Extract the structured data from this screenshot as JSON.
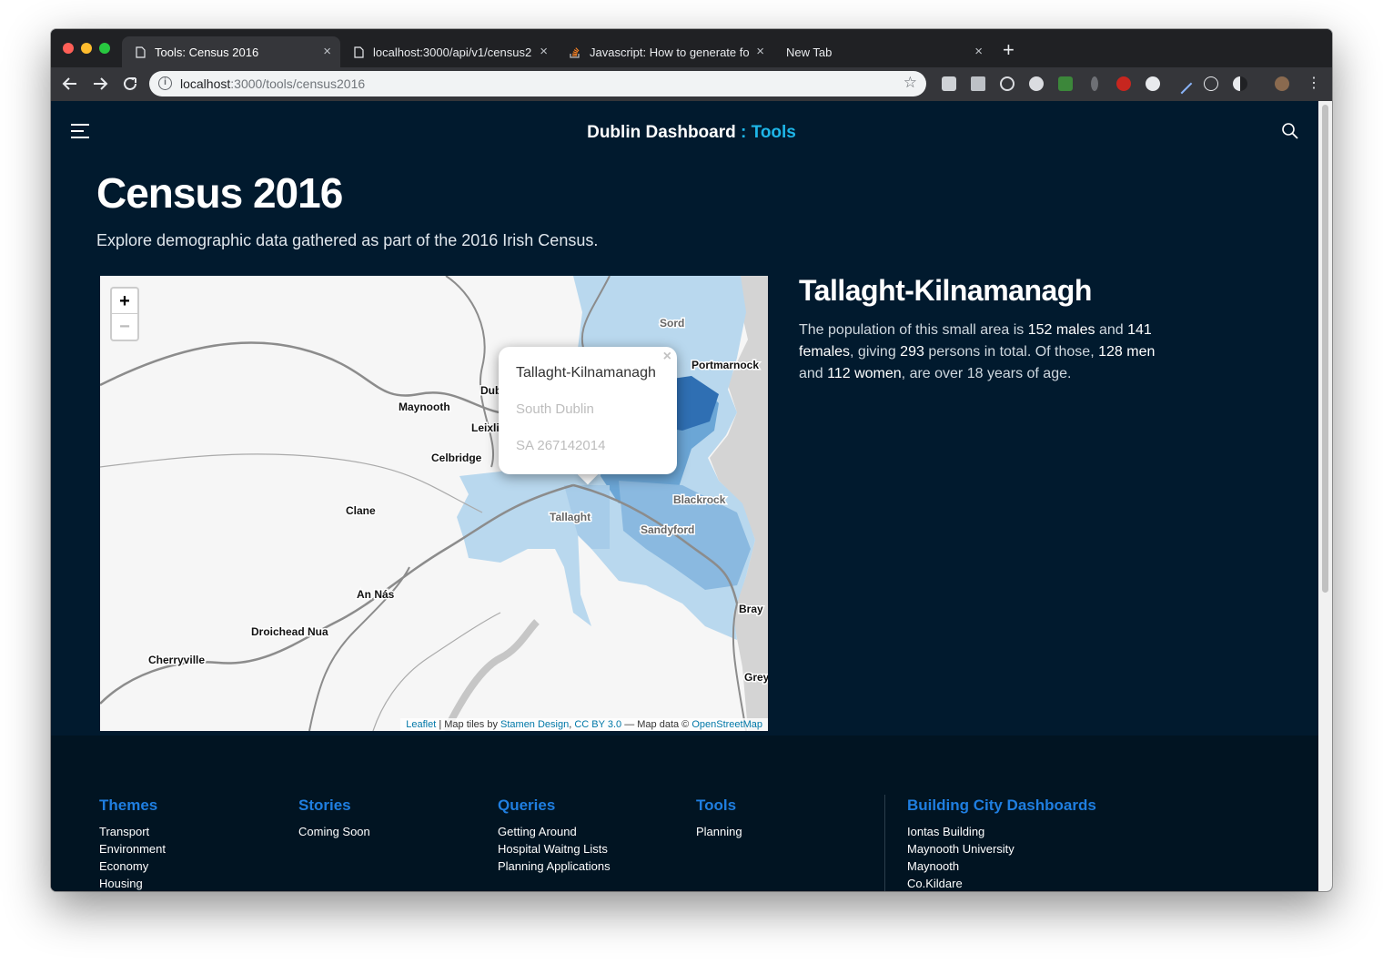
{
  "browser": {
    "tabs": [
      {
        "title": "Tools: Census 2016",
        "icon": "page-icon",
        "active": true
      },
      {
        "title": "localhost:3000/api/v1/census2",
        "icon": "page-icon",
        "active": false
      },
      {
        "title": "Javascript: How to generate fo",
        "icon": "stackoverflow-icon",
        "active": false
      },
      {
        "title": "New Tab",
        "icon": "",
        "active": false
      }
    ],
    "url_host": "localhost",
    "url_path": ":3000/tools/census2016"
  },
  "header": {
    "brand": "Dublin Dashboard",
    "section": ": Tools"
  },
  "page": {
    "title": "Census 2016",
    "subtitle": "Explore demographic data gathered as part of the 2016 Irish Census."
  },
  "map": {
    "zoom_in": "+",
    "zoom_out": "−",
    "popup": {
      "name": "Tallaght-Kilnamanagh",
      "county": "South Dublin",
      "sa_code": "SA 267142014",
      "close": "×"
    },
    "labels": [
      "Sord",
      "Portmarnock",
      "Maynooth",
      "Dub",
      "Leixli",
      "Celbridge",
      "Clane",
      "Tallaght",
      "Blackrock",
      "Sandyford",
      "An Nás",
      "Droichead Nua",
      "Cherryville",
      "Bray",
      "Grey"
    ],
    "attribution": {
      "leaflet": "Leaflet",
      "tiles_prefix": " | Map tiles by ",
      "stamen": "Stamen Design",
      "sep": ", ",
      "cc": "CC BY 3.0",
      "data_prefix": " — Map data © ",
      "osm": "OpenStreetMap"
    }
  },
  "area": {
    "title": "Tallaght-Kilnamanagh",
    "text1": "The population of this small area is ",
    "males": "152 males",
    "text2": " and ",
    "females": "141 females",
    "text3": ", giving ",
    "persons": "293",
    "text4": " persons in total. Of those, ",
    "men": "128 men",
    "text5": " and ",
    "women": "112 women",
    "text6": ", are over 18 years of age."
  },
  "footer": {
    "columns": [
      {
        "heading": "Themes",
        "items": [
          "Transport",
          "Environment",
          "Economy",
          "Housing"
        ]
      },
      {
        "heading": "Stories",
        "items": [
          "Coming Soon"
        ]
      },
      {
        "heading": "Queries",
        "items": [
          "Getting Around",
          "Hospital Waitng Lists",
          "Planning Applications"
        ]
      },
      {
        "heading": "Tools",
        "items": [
          "Planning"
        ]
      },
      {
        "heading": "Building City Dashboards",
        "items": [
          "Iontas Building",
          "Maynooth University",
          "Maynooth",
          "Co.Kildare"
        ]
      }
    ]
  },
  "colors": {
    "page_bg": "#011a2e",
    "accent": "#1eb6e8",
    "footer_heading": "#1f7ee0"
  }
}
